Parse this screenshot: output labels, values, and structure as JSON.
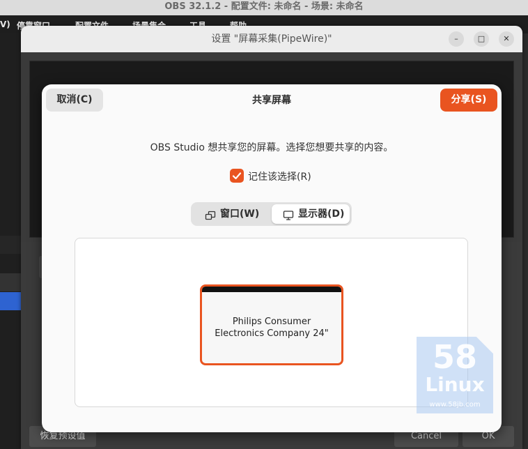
{
  "obs": {
    "window_title": "OBS 32.1.2 - 配置文件: 未命名 - 场景: 未命名",
    "menu_items": [
      "V)",
      "停靠窗口",
      "配置文件",
      "场景集合",
      "工具",
      "帮助"
    ]
  },
  "settings": {
    "title": "设置 \"屏幕采集(PipeWire)\"",
    "minimize": "–",
    "maximize": "□",
    "close": "✕",
    "restore_defaults": "恢复预设值",
    "cancel": "Cancel",
    "ok": "OK"
  },
  "portal": {
    "cancel": "取消(C)",
    "title": "共享屏幕",
    "share": "分享(S)",
    "description": "OBS Studio 想共享您的屏幕。选择您想要共享的内容。",
    "remember_label": "记住该选择(R)",
    "remember_checked": true,
    "toggle_window": "窗口(W)",
    "toggle_monitor": "显示器(D)",
    "selected_toggle": "monitor",
    "monitors": [
      {
        "name_line1": "Philips Consumer",
        "name_line2": "Electronics Company 24\"",
        "selected": true
      }
    ]
  },
  "watermark": {
    "number": "58",
    "word": "Linux",
    "url": "www.58jb.com"
  },
  "colors": {
    "accent": "#e95420",
    "dialog_bg": "#fafafa",
    "obs_bg": "#2b2b2b"
  }
}
